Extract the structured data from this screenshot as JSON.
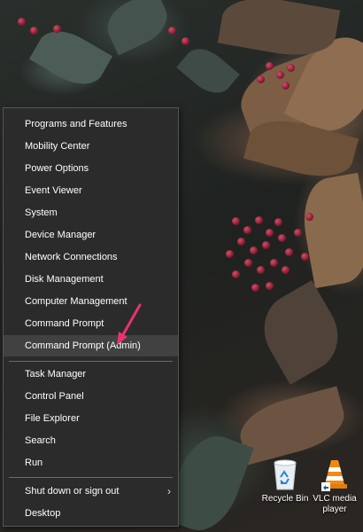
{
  "menu": {
    "items": [
      {
        "label": "Programs and Features"
      },
      {
        "label": "Mobility Center"
      },
      {
        "label": "Power Options"
      },
      {
        "label": "Event Viewer"
      },
      {
        "label": "System"
      },
      {
        "label": "Device Manager"
      },
      {
        "label": "Network Connections"
      },
      {
        "label": "Disk Management"
      },
      {
        "label": "Computer Management"
      },
      {
        "label": "Command Prompt"
      },
      {
        "label": "Command Prompt (Admin)"
      },
      {
        "label": "Task Manager"
      },
      {
        "label": "Control Panel"
      },
      {
        "label": "File Explorer"
      },
      {
        "label": "Search"
      },
      {
        "label": "Run"
      },
      {
        "label": "Shut down or sign out"
      },
      {
        "label": "Desktop"
      }
    ],
    "highlighted_item": "Command Prompt (Admin)",
    "submenu_indicator": "chevron-right-icon"
  },
  "desktop": {
    "icons": [
      {
        "label": "Recycle Bin",
        "icon": "recycle-bin-icon"
      },
      {
        "label": "VLC media player",
        "icon": "vlc-cone-icon"
      }
    ]
  },
  "annotation": {
    "icon": "pointer-arrow-icon",
    "color": "#e8336d"
  },
  "colors": {
    "menu_bg": "#2b2b2b",
    "menu_highlight": "#414141",
    "menu_text": "#ffffff"
  }
}
